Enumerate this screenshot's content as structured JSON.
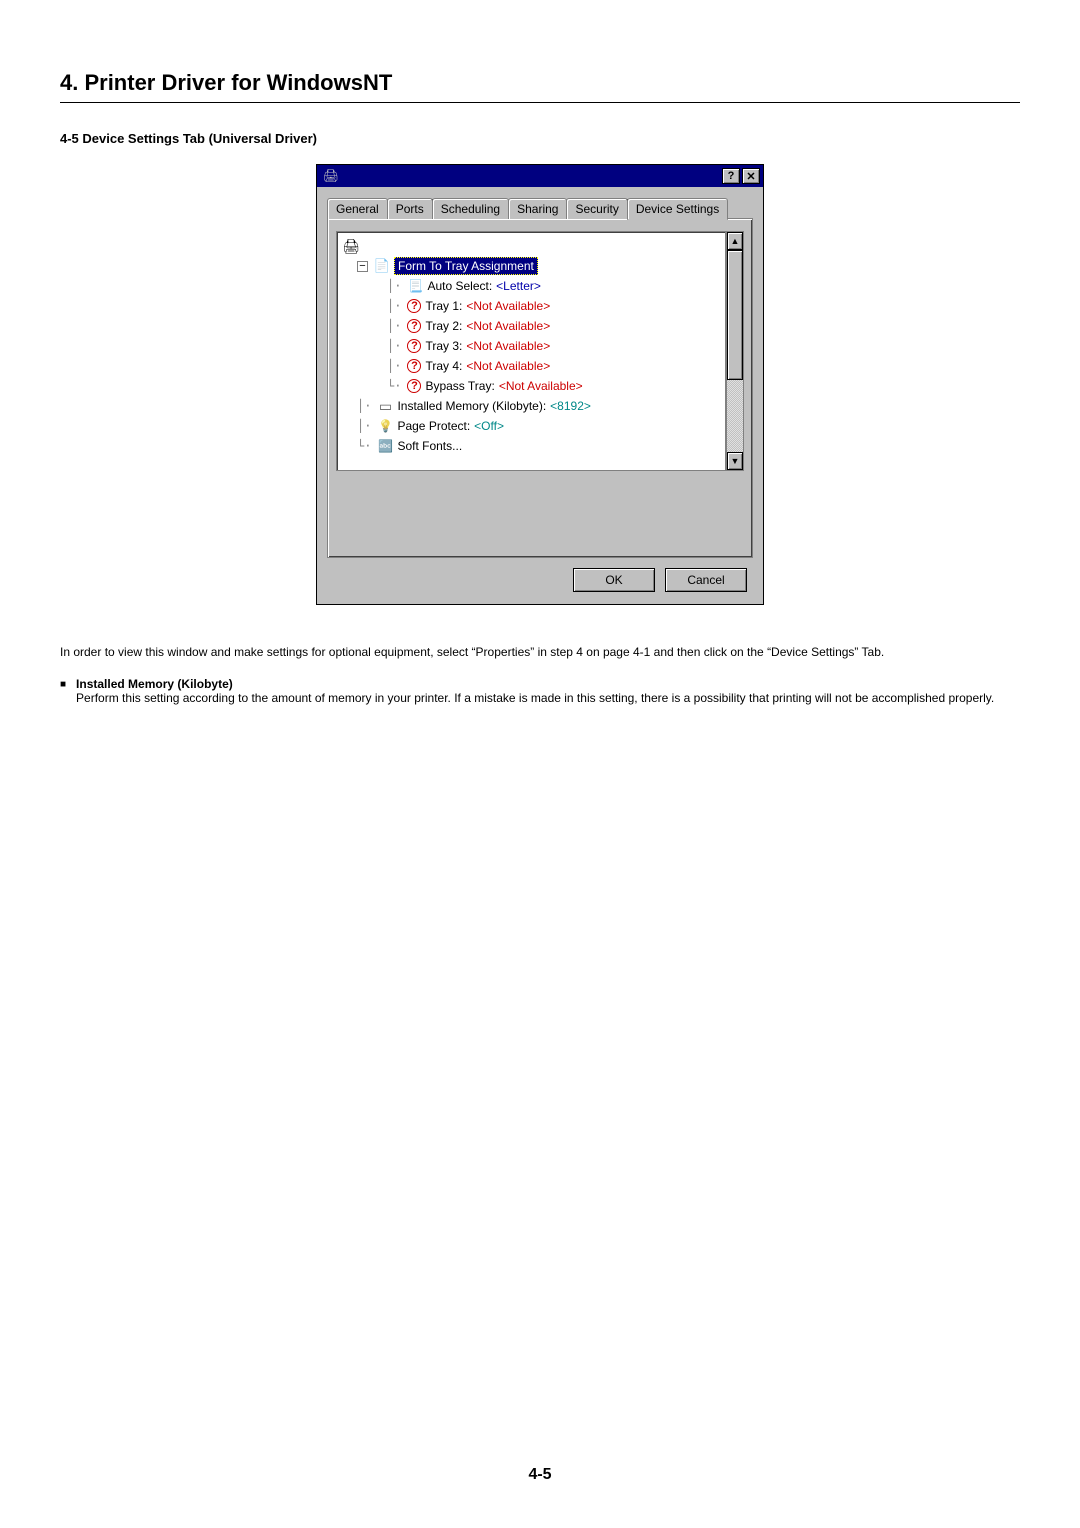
{
  "chapter": {
    "title": "4. Printer Driver for WindowsNT"
  },
  "section": {
    "title": "4-5 Device Settings Tab (Universal Driver)"
  },
  "dialog": {
    "titlebar": {
      "help_label": "?",
      "close_label": "✕"
    },
    "tabs": {
      "items": [
        {
          "label": "General"
        },
        {
          "label": "Ports"
        },
        {
          "label": "Scheduling"
        },
        {
          "label": "Sharing"
        },
        {
          "label": "Security"
        },
        {
          "label": "Device Settings"
        }
      ],
      "active_index": 5
    },
    "tree": {
      "form_assignment": {
        "label": "Form To Tray Assignment",
        "items": [
          {
            "label": "Auto Select: ",
            "value": "<Letter>",
            "value_style": "blue",
            "icon": "doc"
          },
          {
            "label": "Tray 1: ",
            "value": "<Not Available>",
            "value_style": "red",
            "icon": "q"
          },
          {
            "label": "Tray 2: ",
            "value": "<Not Available>",
            "value_style": "red",
            "icon": "q"
          },
          {
            "label": "Tray 3: ",
            "value": "<Not Available>",
            "value_style": "red",
            "icon": "q"
          },
          {
            "label": "Tray 4: ",
            "value": "<Not Available>",
            "value_style": "red",
            "icon": "q"
          },
          {
            "label": "Bypass Tray: ",
            "value": "<Not Available>",
            "value_style": "red",
            "icon": "q"
          }
        ]
      },
      "memory": {
        "label": "Installed Memory (Kilobyte): ",
        "value": "<8192>"
      },
      "page_protect": {
        "label": "Page Protect: ",
        "value": "<Off>"
      },
      "soft_fonts": {
        "label": "Soft Fonts..."
      }
    },
    "buttons": {
      "ok": "OK",
      "cancel": "Cancel"
    }
  },
  "paragraph1": "In order to view this window and make settings for optional equipment, select “Properties” in step 4 on page 4-1 and then click on the “Device Settings” Tab.",
  "bullet": {
    "heading": "Installed Memory (Kilobyte)",
    "body": "Perform this setting according to the amount of memory in your printer. If a mistake is made in this setting, there is a possibility that printing will not be accomplished properly."
  },
  "page_number": "4-5"
}
